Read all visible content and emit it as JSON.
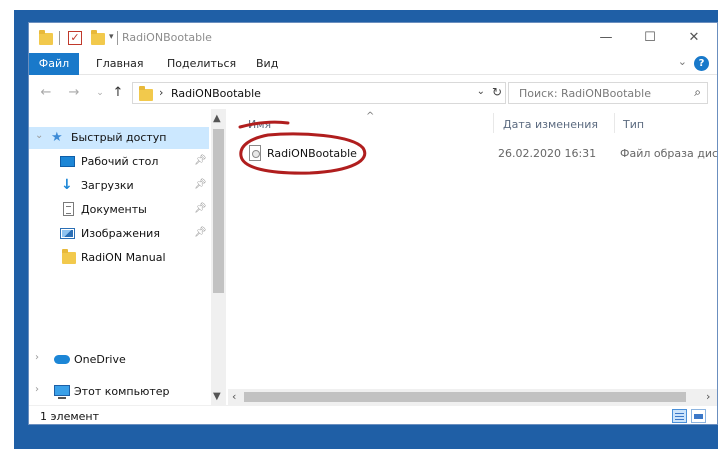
{
  "window": {
    "title": "RadiONBootable",
    "controls": {
      "minimize": "—",
      "maximize": "☐",
      "close": "✕"
    }
  },
  "ribbon": {
    "tabs": [
      "Файл",
      "Главная",
      "Поделиться",
      "Вид"
    ],
    "help": "?",
    "collapse": "⌄"
  },
  "address": {
    "crumb": "RadiONBootable",
    "search_placeholder": "Поиск: RadiONBootable"
  },
  "nav": {
    "items": [
      {
        "label": "Быстрый доступ",
        "icon": "star-icon",
        "selected": true
      },
      {
        "label": "Рабочий стол",
        "icon": "desktop-icon",
        "pinned": true
      },
      {
        "label": "Загрузки",
        "icon": "downloads-icon",
        "pinned": true
      },
      {
        "label": "Документы",
        "icon": "documents-icon",
        "pinned": true
      },
      {
        "label": "Изображения",
        "icon": "pictures-icon",
        "pinned": true
      },
      {
        "label": "RadiON Manual",
        "icon": "folder-icon"
      },
      {
        "label": "OneDrive",
        "icon": "onedrive-icon"
      },
      {
        "label": "Этот компьютер",
        "icon": "computer-icon"
      }
    ]
  },
  "content": {
    "columns": {
      "name": "Имя",
      "date": "Дата изменения",
      "type": "Тип"
    },
    "files": [
      {
        "name": "RadiONBootable",
        "date": "26.02.2020 16:31",
        "type": "Файл образа диска",
        "icon": "disc-image-icon"
      }
    ]
  },
  "status": {
    "count": "1 элемент"
  },
  "colors": {
    "accent": "#1979ca",
    "selection": "#cce8ff",
    "annotation": "#b01e1e",
    "backdrop": "#1f5fa6"
  }
}
